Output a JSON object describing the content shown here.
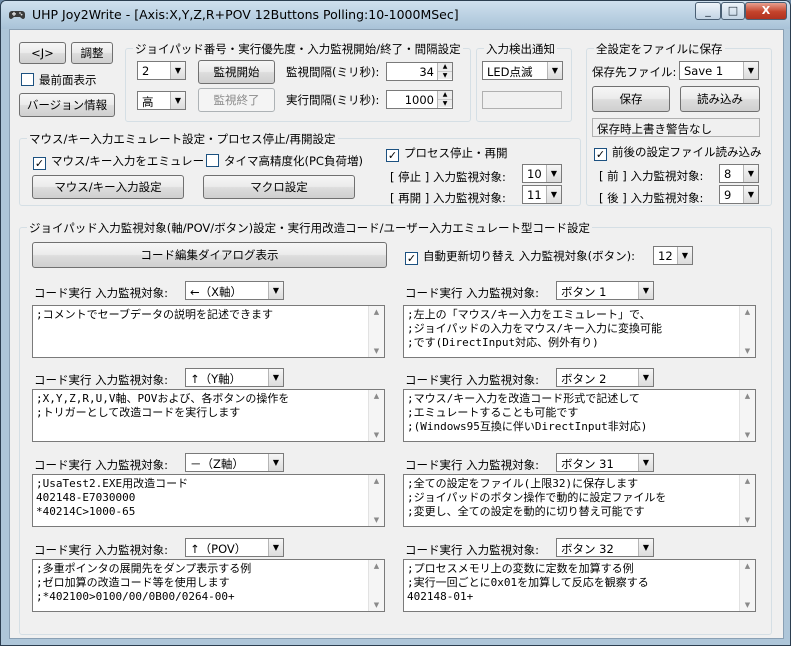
{
  "window": {
    "title": "UHP Joy2Write - [Axis:X,Y,Z,R+POV  12Buttons  Polling:10-1000MSec]",
    "minimize_glyph": "_",
    "maximize_glyph": "□",
    "close_glyph": "X"
  },
  "top_left": {
    "about_button": "<J>",
    "settings_button": "調整",
    "always_on_top_label": "最前面表示",
    "always_on_top_checked": false,
    "version_button": "バージョン情報"
  },
  "joypad_group": {
    "title": "ジョイパッド番号・実行優先度・入力監視開始/終了・間隔設定",
    "joypad_number": "2",
    "priority": "高",
    "start_button": "監視開始",
    "stop_button": "監視終了",
    "monitor_interval_label": "監視間隔(ミリ秒):",
    "monitor_interval_value": "34",
    "exec_interval_label": "実行間隔(ミリ秒):",
    "exec_interval_value": "1000"
  },
  "input_detect_group": {
    "title": "入力検出通知",
    "mode": "LED点滅",
    "indicator": ""
  },
  "save_group": {
    "title": "全設定をファイルに保存",
    "dest_label": "保存先ファイル:",
    "dest_value": "Save 1",
    "save_button": "保存",
    "load_button": "読み込み",
    "status": "保存時上書き警告なし",
    "prev_next_label": "前後の設定ファイル読み込み",
    "prev_next_checked": true,
    "prev_label": "[ 前 ] 入力監視対象:",
    "prev_value": "8",
    "next_label": "[ 後 ] 入力監視対象:",
    "next_value": "9"
  },
  "emulate_group": {
    "title": "マウス/キー入力エミュレート設定・プロセス停止/再開設定",
    "emulate_label": "マウス/キー入力をエミュレート",
    "emulate_checked": true,
    "timer_label": "タイマ高精度化(PC負荷増)",
    "timer_checked": false,
    "mouse_key_button": "マウス/キー入力設定",
    "macro_button": "マクロ設定",
    "process_label": "プロセス停止・再開",
    "process_checked": true,
    "stop_label": "[ 停止 ] 入力監視対象:",
    "stop_value": "10",
    "resume_label": "[ 再開 ] 入力監視対象:",
    "resume_value": "11"
  },
  "code_group": {
    "title": "ジョイパッド入力監視対象(軸/POV/ボタン)設定・実行用改造コード/ユーザー入力エミュレート型コード設定",
    "edit_button": "コード編集ダイアログ表示",
    "auto_switch_label": "自動更新切り替え 入力監視対象(ボタン):",
    "auto_switch_checked": true,
    "auto_switch_value": "12",
    "entries": [
      {
        "label": "コード実行 入力監視対象:",
        "target": "←（X軸）",
        "code": ";コメントでセーブデータの説明を記述できます"
      },
      {
        "label": "コード実行 入力監視対象:",
        "target": "ボタン 1",
        "code": ";左上の「マウス/キー入力をエミュレート」で、\n;ジョイパッドの入力をマウス/キー入力に変換可能\n;です(DirectInput対応、例外有り)"
      },
      {
        "label": "コード実行 入力監視対象:",
        "target": "↑（Y軸）",
        "code": ";X,Y,Z,R,U,V軸、POVおよび、各ボタンの操作を\n;トリガーとして改造コードを実行します"
      },
      {
        "label": "コード実行 入力監視対象:",
        "target": "ボタン 2",
        "code": ";マウス/キー入力を改造コード形式で記述して\n;エミュレートすることも可能です\n;(Windows95互換に伴いDirectInput非対応)"
      },
      {
        "label": "コード実行 入力監視対象:",
        "target": "－（Z軸）",
        "code": ";UsaTest2.EXE用改造コード\n402148-E7030000\n*40214C>1000-65"
      },
      {
        "label": "コード実行 入力監視対象:",
        "target": "ボタン 31",
        "code": ";全ての設定をファイル(上限32)に保存します\n;ジョイパッドのボタン操作で動的に設定ファイルを\n;変更し、全ての設定を動的に切り替え可能です"
      },
      {
        "label": "コード実行 入力監視対象:",
        "target": "↑（POV）",
        "code": ";多重ポインタの展開先をダンプ表示する例\n;ゼロ加算の改造コード等を使用します\n;*402100>0100/00/0B00/0264-00+"
      },
      {
        "label": "コード実行 入力監視対象:",
        "target": "ボタン 32",
        "code": ";プロセスメモリ上の変数に定数を加算する例\n;実行一回ごとに0x01を加算して反応を観察する\n402148-01+"
      }
    ]
  }
}
